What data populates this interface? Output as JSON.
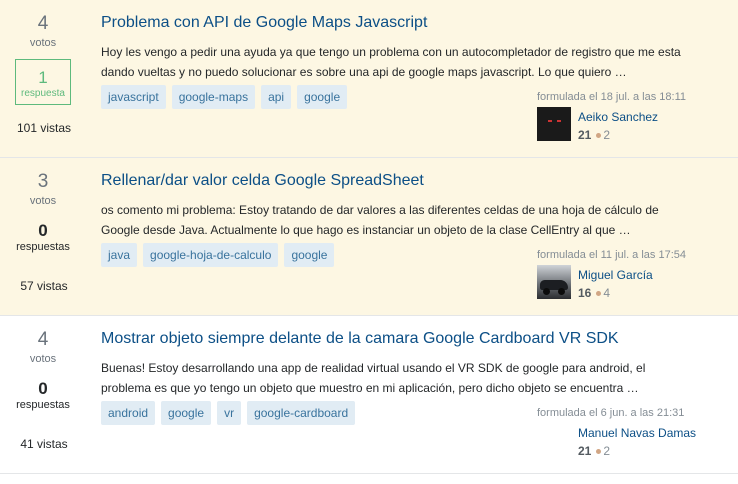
{
  "questions": [
    {
      "votes": "4",
      "votes_label": "votos",
      "answers": "1",
      "answers_label": "respuesta",
      "views": "101 vistas",
      "title": "Problema con API de Google Maps Javascript",
      "excerpt_line1": "Hoy les vengo a pedir una ayuda ya que tengo un problema con un autocompletador de registro que me esta",
      "excerpt_line2": "dando vueltas y no puedo solucionar es sobre una api de google maps javascript. Lo que quiero …",
      "tags": [
        "javascript",
        "google-maps",
        "api",
        "google"
      ],
      "asked": "formulada el 18 jul. a las 18:11",
      "user_name": "Aeiko Sanchez",
      "reputation": "21",
      "bronze": "2"
    },
    {
      "votes": "3",
      "votes_label": "votos",
      "answers": "0",
      "answers_label": "respuestas",
      "views": "57 vistas",
      "title": "Rellenar/dar valor celda Google SpreadSheet",
      "excerpt_line1": "os comento mi problema: Estoy tratando de dar valores a las diferentes celdas de una hoja de cálculo de",
      "excerpt_line2": "Google desde Java. Actualmente lo que hago es instanciar un objeto de la clase CellEntry al que …",
      "tags": [
        "java",
        "google-hoja-de-calculo",
        "google"
      ],
      "asked": "formulada el 11 jul. a las 17:54",
      "user_name": "Miguel García",
      "reputation": "16",
      "bronze": "4"
    },
    {
      "votes": "4",
      "votes_label": "votos",
      "answers": "0",
      "answers_label": "respuestas",
      "views": "41 vistas",
      "title": "Mostrar objeto siempre delante de la camara Google Cardboard VR SDK",
      "excerpt_line1": "Buenas! Estoy desarrollando una app de realidad virtual usando el VR SDK de google para android, el",
      "excerpt_line2": "problema es que yo tengo un objeto que muestro en mi aplicación, pero dicho objeto se encuentra …",
      "tags": [
        "android",
        "google",
        "vr",
        "google-cardboard"
      ],
      "asked": "formulada el 6 jun. a las 21:31",
      "user_name": "Manuel Navas Damas",
      "reputation": "21",
      "bronze": "2"
    }
  ],
  "colors": {
    "highlight_background": "#fdf7e3",
    "title_link": "#0c4f86",
    "tag_background": "#e1ecf4",
    "tag_text": "#39739d",
    "accepted_green": "#5eba7d",
    "bronze_badge": "#d1a684"
  }
}
